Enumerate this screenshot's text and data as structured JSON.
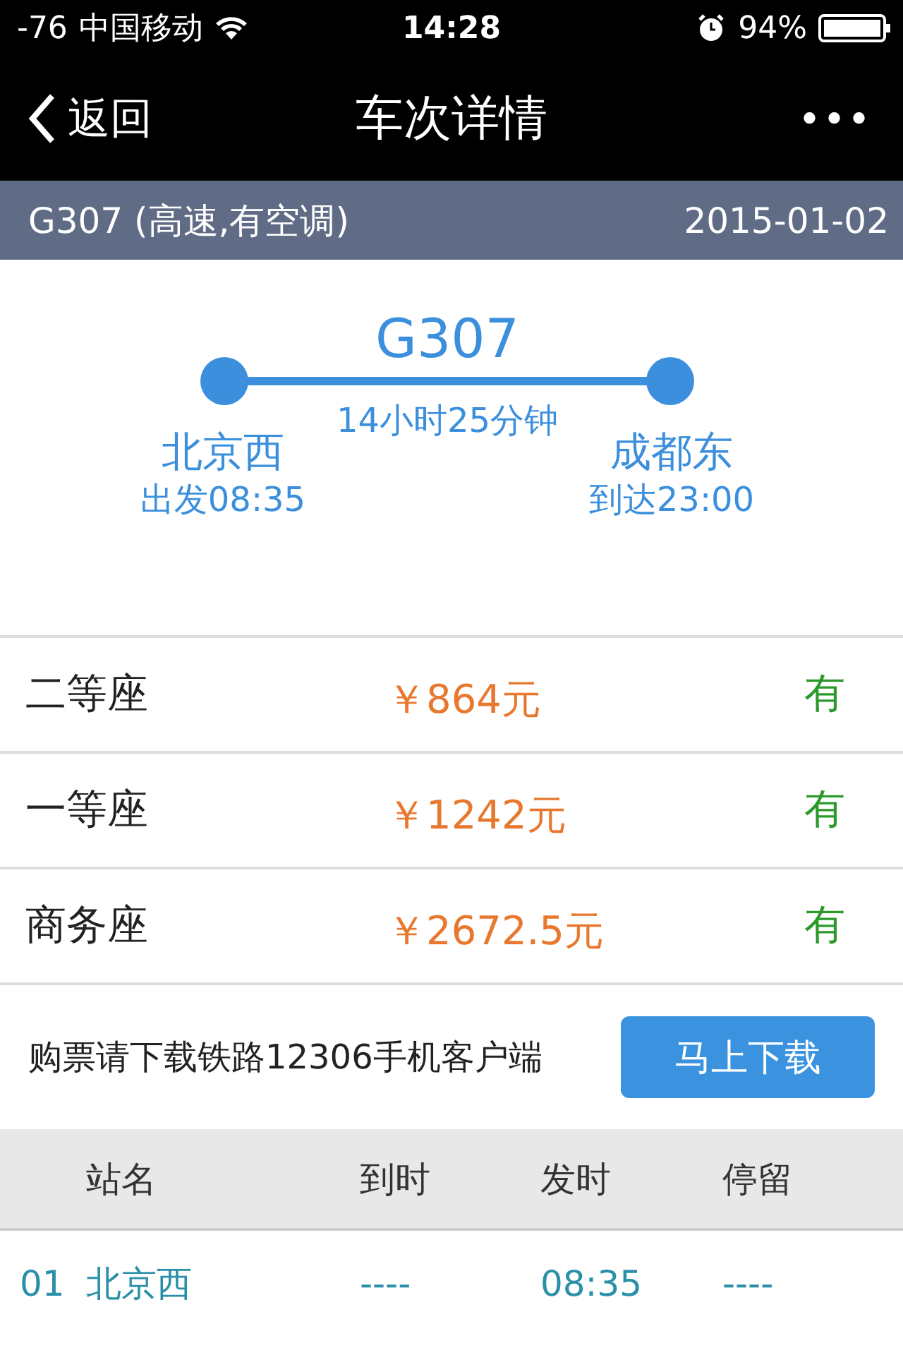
{
  "status_bar": {
    "signal": "-76",
    "carrier": "中国移动",
    "time": "14:28",
    "battery": "94%"
  },
  "nav": {
    "back": "返回",
    "title": "车次详情",
    "more": "•••"
  },
  "train_bar": {
    "train": "G307 (高速,有空调)",
    "date": "2015-01-02"
  },
  "route": {
    "train": "G307",
    "duration": "14小时25分钟",
    "from": {
      "station": "北京西",
      "time": "出发08:35"
    },
    "to": {
      "station": "成都东",
      "time": "到达23:00"
    }
  },
  "seats": [
    {
      "class": "二等座",
      "price": "￥864元",
      "availability": "有"
    },
    {
      "class": "一等座",
      "price": "￥1242元",
      "availability": "有"
    },
    {
      "class": "商务座",
      "price": "￥2672.5元",
      "availability": "有"
    }
  ],
  "download": {
    "text": "购票请下载铁路12306手机客户端",
    "button": "马上下载"
  },
  "table": {
    "columns": [
      "站名",
      "到时",
      "发时",
      "停留"
    ],
    "rows": [
      {
        "no": "01",
        "station": "北京西",
        "arrive": "----",
        "depart": "08:35",
        "stop": "----"
      }
    ]
  }
}
